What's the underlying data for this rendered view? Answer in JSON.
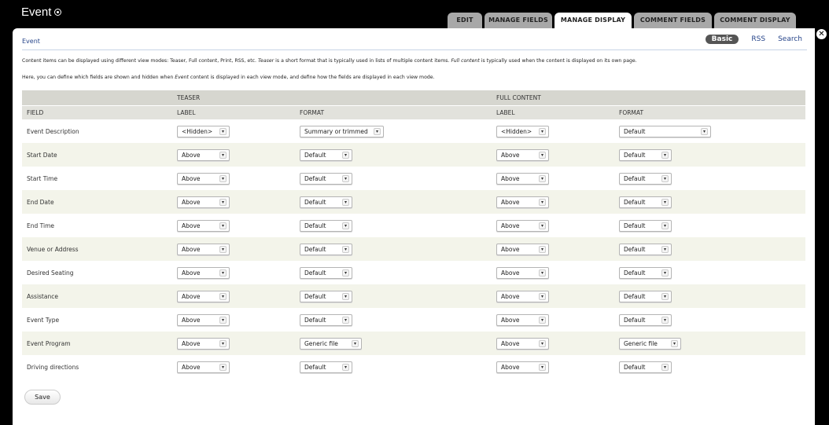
{
  "header": {
    "title": "Event"
  },
  "tabs": [
    {
      "label": "EDIT",
      "active": false
    },
    {
      "label": "MANAGE FIELDS",
      "active": false
    },
    {
      "label": "MANAGE DISPLAY",
      "active": true
    },
    {
      "label": "COMMENT FIELDS",
      "active": false
    },
    {
      "label": "COMMENT DISPLAY",
      "active": false
    }
  ],
  "breadcrumb": "Event",
  "subtabs": [
    {
      "label": "Basic",
      "active": true
    },
    {
      "label": "RSS",
      "active": false
    },
    {
      "label": "Search",
      "active": false
    }
  ],
  "help": {
    "p1_a": "Content items can be displayed using different view modes: Teaser, Full content, Print, RSS, etc. ",
    "p1_teaser": "Teaser",
    "p1_b": " is a short format that is typically used in lists of multiple content items. ",
    "p1_full": "Full content",
    "p1_c": " is typically used when the content is displayed on its own page.",
    "p2_a": "Here, you can define which fields are shown and hidden when ",
    "p2_event": "Event",
    "p2_b": " content is displayed in each view mode, and define how the fields are displayed in each view mode."
  },
  "table": {
    "group_teaser": "TEASER",
    "group_full": "FULL CONTENT",
    "col_field": "FIELD",
    "col_label": "LABEL",
    "col_format": "FORMAT",
    "rows": [
      {
        "field": "Event Description",
        "t_label": "<Hidden>",
        "t_format": "Summary or trimmed",
        "f_label": "<Hidden>",
        "f_format": "Default"
      },
      {
        "field": "Start Date",
        "t_label": "Above",
        "t_format": "Default",
        "f_label": "Above",
        "f_format": "Default"
      },
      {
        "field": "Start Time",
        "t_label": "Above",
        "t_format": "Default",
        "f_label": "Above",
        "f_format": "Default"
      },
      {
        "field": "End Date",
        "t_label": "Above",
        "t_format": "Default",
        "f_label": "Above",
        "f_format": "Default"
      },
      {
        "field": "End Time",
        "t_label": "Above",
        "t_format": "Default",
        "f_label": "Above",
        "f_format": "Default"
      },
      {
        "field": "Venue or Address",
        "t_label": "Above",
        "t_format": "Default",
        "f_label": "Above",
        "f_format": "Default"
      },
      {
        "field": "Desired Seating",
        "t_label": "Above",
        "t_format": "Default",
        "f_label": "Above",
        "f_format": "Default"
      },
      {
        "field": "Assistance",
        "t_label": "Above",
        "t_format": "Default",
        "f_label": "Above",
        "f_format": "Default"
      },
      {
        "field": "Event Type",
        "t_label": "Above",
        "t_format": "Default",
        "f_label": "Above",
        "f_format": "Default"
      },
      {
        "field": "Event Program",
        "t_label": "Above",
        "t_format": "Generic file",
        "f_label": "Above",
        "f_format": "Generic file"
      },
      {
        "field": "Driving directions",
        "t_label": "Above",
        "t_format": "Default",
        "f_label": "Above",
        "f_format": "Default"
      }
    ]
  },
  "save_label": "Save",
  "icons": {
    "title": "settings-circle-icon",
    "close": "close-icon",
    "dropdown": "dropdown-arrow-icon"
  },
  "colors": {
    "link": "#27458a",
    "tab_active": "#ffffff",
    "tab_inactive": "#a8a8a8",
    "row_even": "#f3f4ea",
    "header_bg": "#e2e2dc"
  }
}
